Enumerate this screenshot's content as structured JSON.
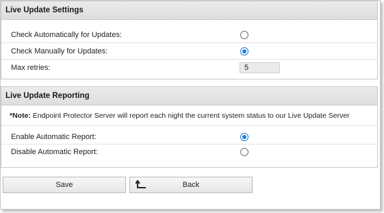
{
  "live_update_settings": {
    "title": "Live Update Settings",
    "rows": [
      {
        "label": "Check Automatically for Updates:",
        "checked": false
      },
      {
        "label": "Check Manually for Updates:",
        "checked": true
      }
    ],
    "max_retries_label": "Max retries:",
    "max_retries_value": "5"
  },
  "live_update_reporting": {
    "title": "Live Update Reporting",
    "note_prefix": "*Note:",
    "note_text": "Endpoint Protector Server will report each night the current system status to our Live Update Server",
    "rows": [
      {
        "label": "Enable Automatic Report:",
        "checked": true
      },
      {
        "label": "Disable Automatic Report:",
        "checked": false
      }
    ]
  },
  "buttons": {
    "save_label": "Save",
    "back_label": "Back"
  },
  "colors": {
    "accent": "#1e7fd6"
  },
  "icons": {
    "back": "back-arrow-icon"
  }
}
